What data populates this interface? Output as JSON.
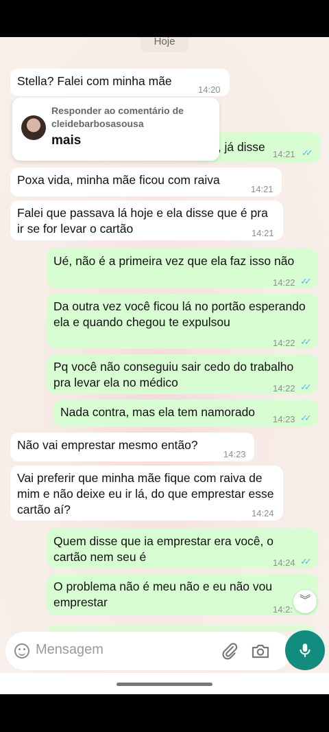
{
  "chat": {
    "date_label": "Hoje",
    "reply_preview": {
      "label": "Responder ao comentário de cleidebarbosasousa",
      "text": "mais"
    },
    "messages": [
      {
        "side": "in",
        "text": "Stella? Falei com minha mãe",
        "time": "14:20"
      },
      {
        "side": "out",
        "text": "o, já disse",
        "time": "14:21",
        "read": true
      },
      {
        "side": "in",
        "text": "Poxa vida, minha mãe ficou com raiva",
        "time": "14:21"
      },
      {
        "side": "in",
        "text": "Falei que passava lá hoje e ela disse que é pra ir se for levar o cartão",
        "time": "14:21"
      },
      {
        "side": "out",
        "text": "Ué, não é a primeira vez que ela faz isso não",
        "time": "14:22",
        "read": true
      },
      {
        "side": "out",
        "text": "Da outra vez você ficou lá no portão esperando ela e quando chegou te expulsou",
        "time": "14:22",
        "read": true
      },
      {
        "side": "out",
        "text": "Pq você não conseguiu sair cedo do trabalho pra levar ela no médico",
        "time": "14:22",
        "read": true
      },
      {
        "side": "out",
        "text": "Nada contra, mas ela tem namorado",
        "time": "14:23",
        "read": true
      },
      {
        "side": "in",
        "text": "Não vai emprestar mesmo então?",
        "time": "14:23"
      },
      {
        "side": "in",
        "text": "Vai preferir que minha mãe fique com raiva de mim e não deixe eu ir lá, do que emprestar esse cartão aí?",
        "time": "14:24"
      },
      {
        "side": "out",
        "text": "Quem disse que ia emprestar era você, o cartão nem seu é",
        "time": "14:24",
        "read": true
      },
      {
        "side": "out",
        "text": "O problema não é meu não e eu não vou emprestar",
        "time": "14:2:",
        "read": false
      }
    ]
  },
  "composer": {
    "placeholder": "Mensagem",
    "icons": [
      "emoji-icon",
      "attach-icon",
      "camera-icon",
      "mic-icon"
    ]
  },
  "colors": {
    "incoming": "#ffffff",
    "outgoing": "#d9fdd3",
    "read_ticks": "#53bdeb",
    "mic_button": "#128c7e"
  }
}
